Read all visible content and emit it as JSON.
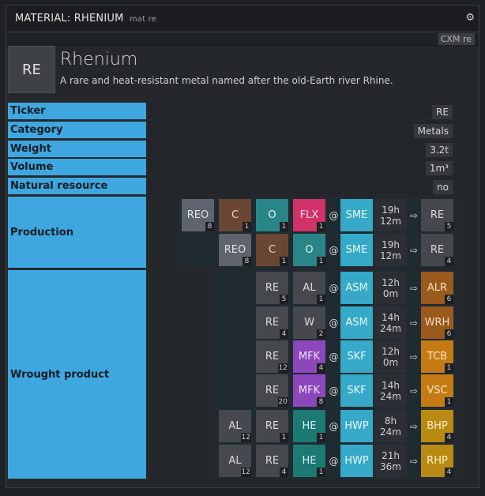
{
  "window": {
    "title": "MATERIAL: RHENIUM",
    "command": "mat re",
    "cxm_label": "CXM re"
  },
  "material": {
    "ticker": "RE",
    "name": "Rhenium",
    "description": "A rare and heat-resistant metal named after the old-Earth river Rhine."
  },
  "properties": [
    {
      "label": "Ticker",
      "value": "RE"
    },
    {
      "label": "Category",
      "value": "Metals"
    },
    {
      "label": "Weight",
      "value": "3.2t"
    },
    {
      "label": "Volume",
      "value": "1m³"
    },
    {
      "label": "Natural resource",
      "value": "no"
    }
  ],
  "production": {
    "label": "Production",
    "recipes": [
      {
        "inputs": [
          {
            "ticker": "REO",
            "count": "8",
            "color": "#5e636d",
            "text": "#e2e2e2"
          },
          {
            "ticker": "C",
            "count": "1",
            "color": "#6a4732",
            "text": "#e6d6c6"
          },
          {
            "ticker": "O",
            "count": "1",
            "color": "#2a8589",
            "text": "#dff2f2"
          },
          {
            "ticker": "FLX",
            "count": "1",
            "color": "#d2326a",
            "text": "#f4dbe4"
          }
        ],
        "at": "@",
        "building": "SME",
        "time": [
          "19h",
          "12m"
        ],
        "arrow": "⇨",
        "output": {
          "ticker": "RE",
          "count": "5",
          "color": "#45484c",
          "text": "#dcdcdc"
        }
      },
      {
        "inputs": [
          {
            "ticker": "REO",
            "count": "8",
            "color": "#5e636d",
            "text": "#e2e2e2"
          },
          {
            "ticker": "C",
            "count": "1",
            "color": "#6a4732",
            "text": "#e6d6c6"
          },
          {
            "ticker": "O",
            "count": "1",
            "color": "#2a8589",
            "text": "#dff2f2"
          }
        ],
        "at": "@",
        "building": "SME",
        "time": [
          "19h",
          "12m"
        ],
        "arrow": "⇨",
        "output": {
          "ticker": "RE",
          "count": "4",
          "color": "#45484c",
          "text": "#dcdcdc"
        }
      }
    ]
  },
  "wrought": {
    "label": "Wrought product",
    "recipes": [
      {
        "inputs": [
          {
            "ticker": "RE",
            "count": "5",
            "color": "#45484c",
            "text": "#dcdcdc"
          },
          {
            "ticker": "AL",
            "count": "1",
            "color": "#45484c",
            "text": "#dcdcdc"
          }
        ],
        "at": "@",
        "building": "ASM",
        "time": [
          "12h",
          "0m"
        ],
        "arrow": "⇨",
        "output": {
          "ticker": "ALR",
          "count": "6",
          "color": "#9a5a1c",
          "text": "#f2dcc2"
        }
      },
      {
        "inputs": [
          {
            "ticker": "RE",
            "count": "4",
            "color": "#45484c",
            "text": "#dcdcdc"
          },
          {
            "ticker": "W",
            "count": "2",
            "color": "#45484c",
            "text": "#dcdcdc"
          }
        ],
        "at": "@",
        "building": "ASM",
        "time": [
          "14h",
          "24m"
        ],
        "arrow": "⇨",
        "output": {
          "ticker": "WRH",
          "count": "6",
          "color": "#9a5a1c",
          "text": "#f2dcc2"
        }
      },
      {
        "inputs": [
          {
            "ticker": "RE",
            "count": "12",
            "color": "#45484c",
            "text": "#dcdcdc"
          },
          {
            "ticker": "MFK",
            "count": "4",
            "color": "#8c47bb",
            "text": "#efe2f7"
          }
        ],
        "at": "@",
        "building": "SKF",
        "time": [
          "12h",
          "0m"
        ],
        "arrow": "⇨",
        "output": {
          "ticker": "TCB",
          "count": "1",
          "color": "#c57b14",
          "text": "#fbe8c8"
        }
      },
      {
        "inputs": [
          {
            "ticker": "RE",
            "count": "20",
            "color": "#45484c",
            "text": "#dcdcdc"
          },
          {
            "ticker": "MFK",
            "count": "8",
            "color": "#8c47bb",
            "text": "#efe2f7"
          }
        ],
        "at": "@",
        "building": "SKF",
        "time": [
          "14h",
          "24m"
        ],
        "arrow": "⇨",
        "output": {
          "ticker": "VSC",
          "count": "1",
          "color": "#c57b14",
          "text": "#fbe8c8"
        }
      },
      {
        "inputs": [
          {
            "ticker": "AL",
            "count": "12",
            "color": "#45484c",
            "text": "#dcdcdc"
          },
          {
            "ticker": "RE",
            "count": "1",
            "color": "#45484c",
            "text": "#dcdcdc"
          },
          {
            "ticker": "HE",
            "count": "1",
            "color": "#1b7a73",
            "text": "#d8efed"
          }
        ],
        "at": "@",
        "building": "HWP",
        "time": [
          "8h",
          "24m"
        ],
        "arrow": "⇨",
        "output": {
          "ticker": "BHP",
          "count": "4",
          "color": "#b88a14",
          "text": "#fbf0c8"
        }
      },
      {
        "inputs": [
          {
            "ticker": "AL",
            "count": "12",
            "color": "#45484c",
            "text": "#dcdcdc"
          },
          {
            "ticker": "RE",
            "count": "4",
            "color": "#45484c",
            "text": "#dcdcdc"
          },
          {
            "ticker": "HE",
            "count": "1",
            "color": "#1b7a73",
            "text": "#d8efed"
          }
        ],
        "at": "@",
        "building": "HWP",
        "time": [
          "21h",
          "36m"
        ],
        "arrow": "⇨",
        "output": {
          "ticker": "RHP",
          "count": "4",
          "color": "#b88a14",
          "text": "#fbf0c8"
        }
      }
    ]
  }
}
